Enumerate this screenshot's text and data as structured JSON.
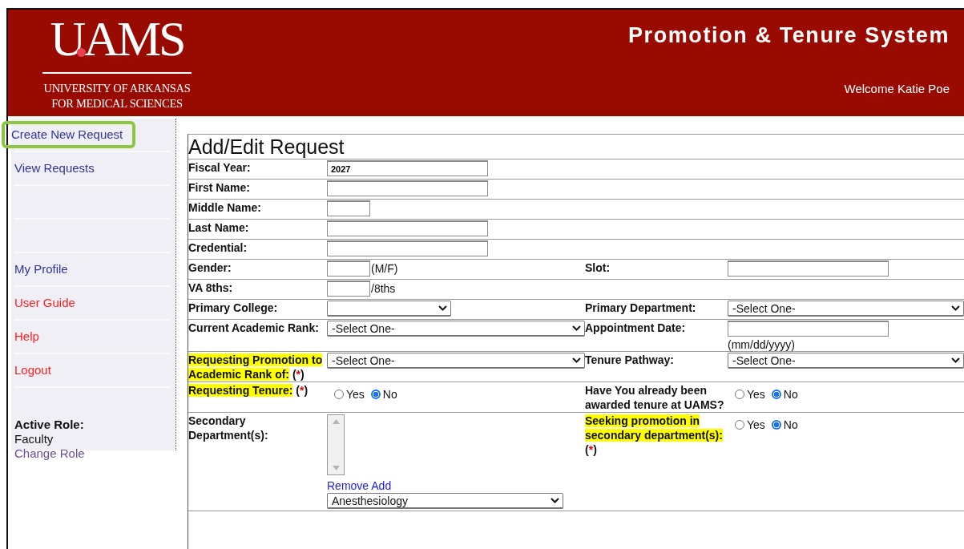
{
  "header": {
    "logo": {
      "wordmark": "UAMS",
      "subtitle": [
        "UNIVERSITY OF ARKANSAS",
        "FOR MEDICAL SCIENCES"
      ]
    },
    "title": "Promotion & Tenure System",
    "welcome": "Welcome Katie Poe"
  },
  "sidebar": {
    "items": [
      {
        "kind": "link",
        "label": "Create New Request",
        "color": "#333399",
        "highlighted": true
      },
      {
        "kind": "link",
        "label": "View Requests",
        "color": "#333399",
        "highlighted": false
      },
      {
        "kind": "blank"
      },
      {
        "kind": "blank"
      },
      {
        "kind": "link",
        "label": "My Profile",
        "color": "#333399",
        "highlighted": false
      },
      {
        "kind": "link",
        "label": "User Guide",
        "color": "#ff2020",
        "highlighted": false
      },
      {
        "kind": "link",
        "label": "Help",
        "color": "#ff2020",
        "highlighted": false
      },
      {
        "kind": "link",
        "label": "Logout",
        "color": "#ff2020",
        "highlighted": false
      }
    ],
    "role_label": "Active Role:",
    "role": "Faculty",
    "change_role": "Change Role"
  },
  "form": {
    "title": "Add/Edit Request",
    "rows": [
      {
        "left": {
          "label": {
            "text": "Fiscal Year:",
            "highlight": false
          },
          "control": {
            "kind": "text",
            "value": "2027"
          }
        }
      },
      {
        "left": {
          "label": {
            "text": "First Name:",
            "highlight": false
          },
          "control": {
            "kind": "text"
          }
        }
      },
      {
        "left": {
          "label": {
            "text": "Middle Name:",
            "highlight": false
          },
          "control": {
            "kind": "short-text"
          }
        }
      },
      {
        "left": {
          "label": {
            "text": "Last Name:",
            "highlight": false
          },
          "control": {
            "kind": "text"
          }
        }
      },
      {
        "left": {
          "label": {
            "text": "Credential:",
            "highlight": false
          },
          "control": {
            "kind": "text"
          }
        }
      },
      {
        "left": {
          "label": {
            "text": "Gender:",
            "highlight": false
          },
          "control": {
            "kind": "short-text",
            "suffix": "(M/F)"
          }
        },
        "right": {
          "label": {
            "text": "Slot:",
            "highlight": false
          },
          "control": {
            "kind": "text"
          }
        }
      },
      {
        "left": {
          "label": {
            "text": "VA 8ths:",
            "highlight": false
          },
          "control": {
            "kind": "short-text",
            "suffix": "/8ths"
          }
        }
      },
      {
        "left": {
          "label": {
            "text": "Primary College:",
            "highlight": false
          },
          "control": {
            "kind": "short-select"
          }
        },
        "right": {
          "label": {
            "text": "Primary Department:",
            "highlight": false
          },
          "control": {
            "kind": "select",
            "value": "-Select One-"
          }
        }
      },
      {
        "left": {
          "label": {
            "text": "Current Academic Rank:",
            "highlight": false
          },
          "control": {
            "kind": "select",
            "value": "-Select One-"
          }
        },
        "right": {
          "label": {
            "text": "Appointment Date:",
            "highlight": false
          },
          "control": {
            "kind": "text",
            "hint": "(mm/dd/yyyy)"
          }
        }
      },
      {
        "left": {
          "label": {
            "text": "Requesting Promotion to Academic Rank of:",
            "highlight": true,
            "required_mark": "(*)"
          },
          "control": {
            "kind": "select",
            "value": "-Select One-"
          }
        },
        "right": {
          "label": {
            "text": "Tenure Pathway:",
            "highlight": false
          },
          "control": {
            "kind": "select",
            "value": "-Select One-"
          }
        }
      },
      {
        "left": {
          "label": {
            "text": "Requesting Tenure:",
            "highlight": true,
            "required_mark": "(*)"
          },
          "control": {
            "kind": "radio",
            "options": [
              {
                "label": "Yes",
                "selected": false
              },
              {
                "label": "No",
                "selected": true
              }
            ]
          }
        },
        "right": {
          "label": {
            "text": "Have You already been awarded tenure at UAMS?",
            "highlight": false
          },
          "control": {
            "kind": "radio",
            "options": [
              {
                "label": "Yes",
                "selected": false
              },
              {
                "label": "No",
                "selected": true
              }
            ]
          }
        }
      },
      {
        "left": {
          "label": {
            "text": "Secondary Department(s):",
            "highlight": false
          },
          "control": {
            "kind": "listbox",
            "links": [
              "Remove",
              "Add"
            ],
            "value": "Anesthesiology"
          }
        },
        "right": {
          "label": {
            "text": "Seeking promotion in secondary department(s):",
            "highlight": true,
            "required_mark": "(*)"
          },
          "control": {
            "kind": "radio",
            "options": [
              {
                "label": "Yes",
                "selected": false
              },
              {
                "label": "No",
                "selected": true
              }
            ]
          }
        }
      }
    ]
  }
}
